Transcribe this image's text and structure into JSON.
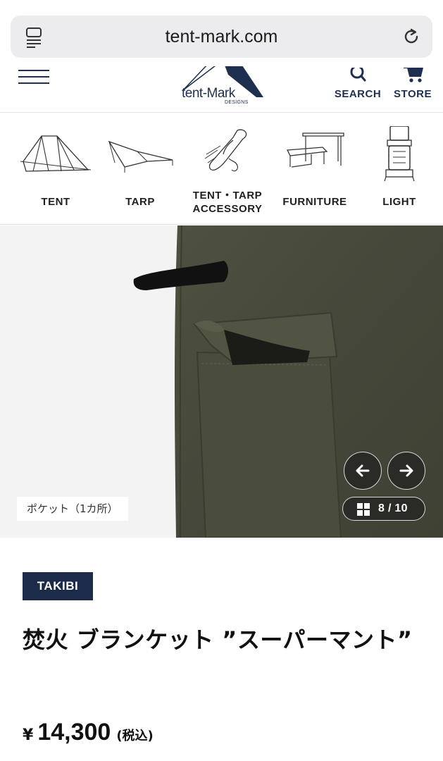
{
  "browser": {
    "url": "tent-mark.com"
  },
  "header": {
    "logo_text": "tent-Mark",
    "logo_sub": "DESIGNS",
    "search_label": "SEARCH",
    "store_label": "STORE"
  },
  "categories": [
    {
      "label": "TENT",
      "icon": "tent-icon"
    },
    {
      "label": "TARP",
      "icon": "tarp-icon"
    },
    {
      "label_line1": "TENT・TARP",
      "label_line2": "ACCESSORY",
      "icon": "accessory-icon"
    },
    {
      "label": "FURNITURE",
      "icon": "furniture-icon"
    },
    {
      "label": "LIGHT",
      "icon": "lantern-icon"
    }
  ],
  "gallery": {
    "caption": "ポケット（1カ所）",
    "counter": "8 / 10"
  },
  "product": {
    "brand": "TAKIBI",
    "title": "焚火 ブランケット ”スーパーマント”",
    "currency": "¥",
    "price": "14,300",
    "tax_note": "(税込)"
  },
  "colors": {
    "navy": "#1c2b4a",
    "fabric_olive": "#4a4c3c",
    "gallery_bg": "#f3f3f3"
  }
}
